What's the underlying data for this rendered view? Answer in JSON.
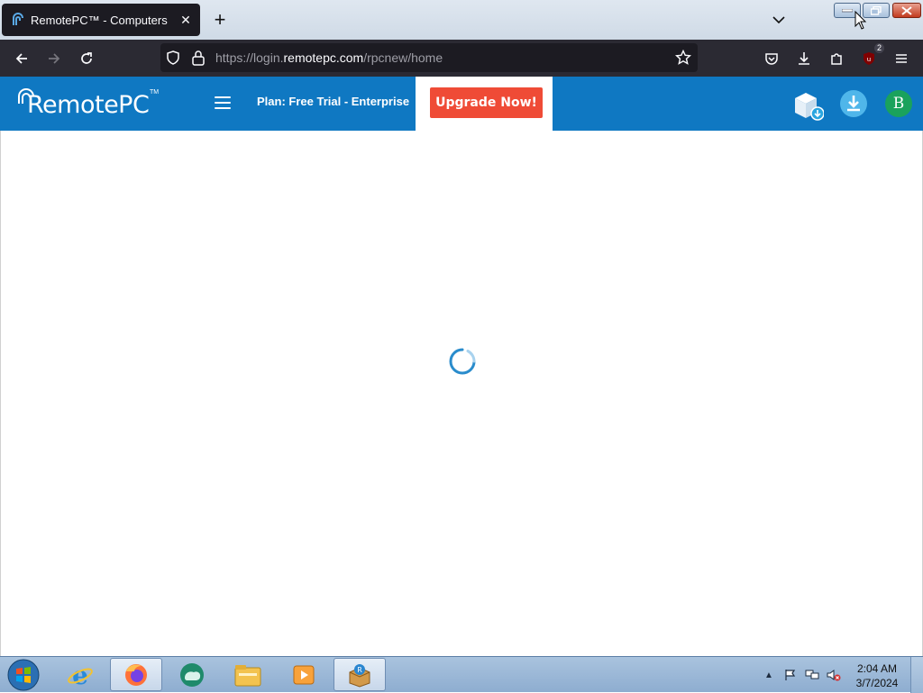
{
  "browser": {
    "tab": {
      "title": "RemotePC™ - Computers",
      "favicon": "remotepc-icon"
    },
    "url": {
      "scheme_prefix": "https://login.",
      "host": "remotepc.com",
      "path": "/rpcnew/home"
    },
    "extensions_badge": "2"
  },
  "app": {
    "logo_text": "RemotePC",
    "logo_tm": "TM",
    "plan_label": "Plan: Free Trial - Enterprise",
    "upgrade_label": "Upgrade Now!",
    "avatar_initial": "B",
    "colors": {
      "header": "#0f78c2",
      "upgrade": "#ef4b36",
      "avatar": "#1aa25c"
    }
  },
  "content": {
    "state": "loading-spinner"
  },
  "taskbar": {
    "pinned": [
      "internet-explorer-icon",
      "firefox-icon",
      "cloud-app-icon",
      "file-explorer-icon",
      "media-player-icon",
      "remotepc-installer-icon"
    ],
    "clock": {
      "time": "2:04 AM",
      "date": "3/7/2024"
    }
  }
}
